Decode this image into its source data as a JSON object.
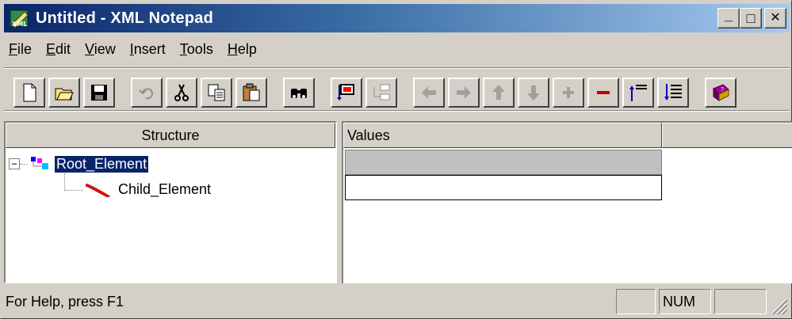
{
  "window": {
    "title": "Untitled - XML Notepad",
    "minimize_label": "_",
    "maximize_label": "□",
    "close_label": "✕"
  },
  "menu": [
    {
      "label": "File",
      "mnemonic": "F"
    },
    {
      "label": "Edit",
      "mnemonic": "E"
    },
    {
      "label": "View",
      "mnemonic": "V"
    },
    {
      "label": "Insert",
      "mnemonic": "I"
    },
    {
      "label": "Tools",
      "mnemonic": "T"
    },
    {
      "label": "Help",
      "mnemonic": "H"
    }
  ],
  "toolbar": {
    "buttons": [
      {
        "name": "new-document",
        "icon": "new-file-icon"
      },
      {
        "name": "open",
        "icon": "open-folder-icon"
      },
      {
        "name": "save",
        "icon": "save-disk-icon"
      },
      {
        "name": "undo",
        "icon": "undo-icon"
      },
      {
        "name": "cut",
        "icon": "scissors-icon"
      },
      {
        "name": "copy",
        "icon": "copy-icon"
      },
      {
        "name": "paste",
        "icon": "paste-icon"
      },
      {
        "name": "find",
        "icon": "binoculars-icon"
      },
      {
        "name": "insert-element",
        "icon": "insert-element-icon"
      },
      {
        "name": "insert-child",
        "icon": "insert-child-icon"
      },
      {
        "name": "move-left",
        "icon": "arrow-left-icon"
      },
      {
        "name": "move-right",
        "icon": "arrow-right-icon"
      },
      {
        "name": "move-up",
        "icon": "arrow-up-icon"
      },
      {
        "name": "move-down",
        "icon": "arrow-down-icon"
      },
      {
        "name": "expand",
        "icon": "plus-icon"
      },
      {
        "name": "collapse",
        "icon": "minus-icon"
      },
      {
        "name": "collapse-all",
        "icon": "collapse-all-icon"
      },
      {
        "name": "expand-all",
        "icon": "expand-all-icon"
      },
      {
        "name": "help-book",
        "icon": "help-book-icon"
      }
    ]
  },
  "structure_pane": {
    "header": "Structure",
    "nodes": [
      {
        "label": "Root_Element",
        "expander": "−",
        "selected": true
      },
      {
        "label": "Child_Element",
        "selected": false
      }
    ]
  },
  "values_pane": {
    "header": "Values",
    "rows": [
      "",
      ""
    ]
  },
  "status": {
    "text": "For Help, press F1",
    "panel_1": "",
    "panel_num": "NUM",
    "panel_3": ""
  }
}
